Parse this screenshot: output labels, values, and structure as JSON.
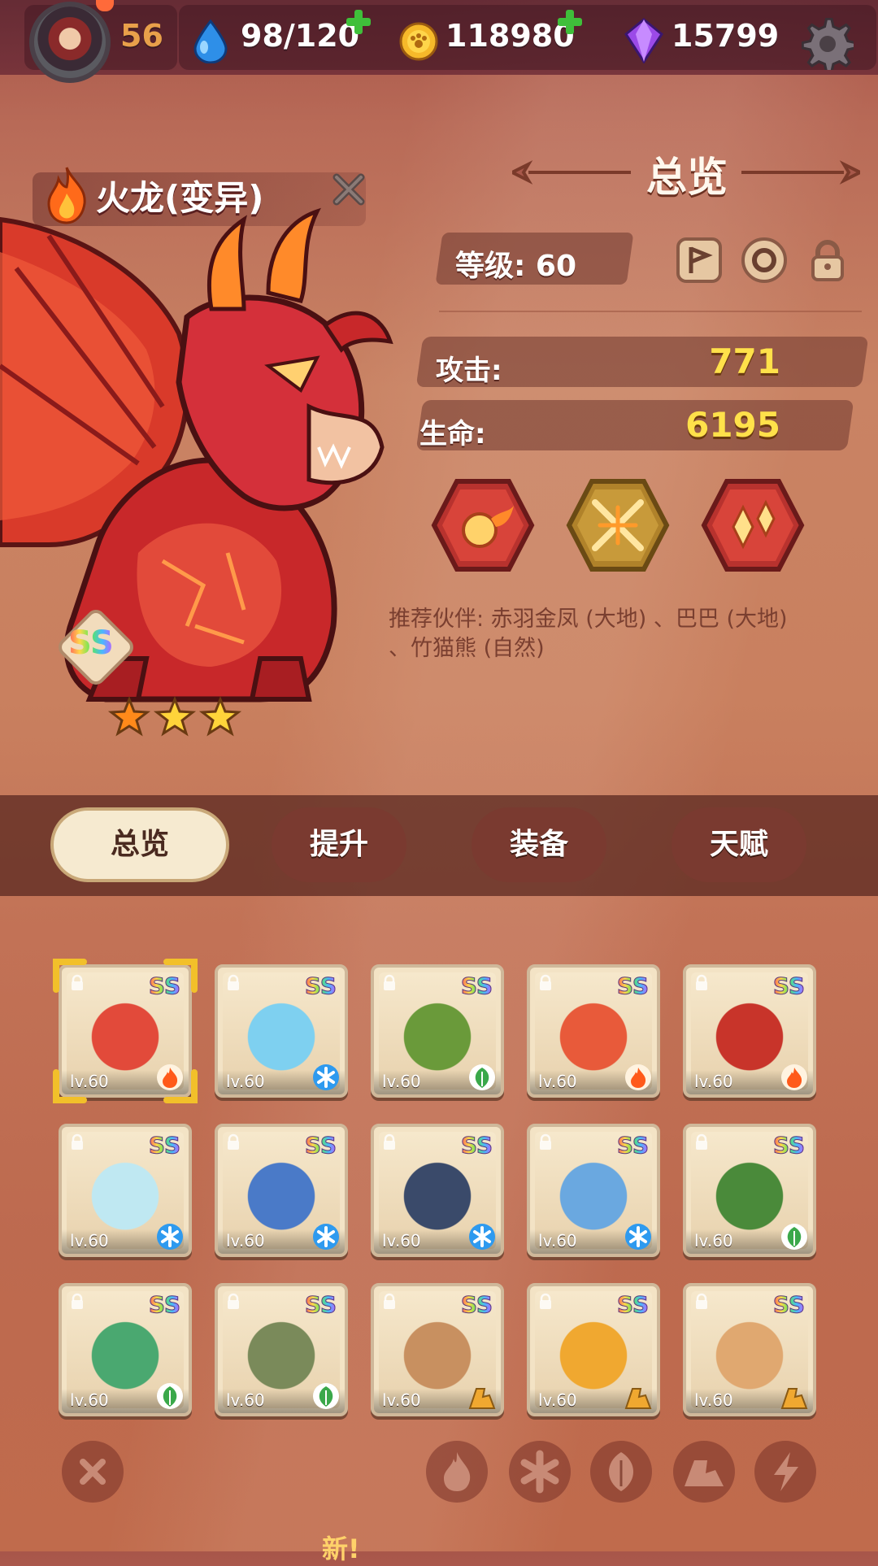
{
  "topbar": {
    "level": "56",
    "stamina": "98/120",
    "coins": "118980",
    "gems": "15799"
  },
  "pet": {
    "name": "火龙(变异)",
    "grade": "SS",
    "stars": 3,
    "element": "fire"
  },
  "overview": {
    "title": "总览",
    "level_label": "等级: 60",
    "attack_label": "攻击:",
    "attack_value": "771",
    "hp_label": "生命:",
    "hp_value": "6195",
    "skills": [
      "fireball-skill-icon",
      "crossed-blades-skill-icon",
      "flame-drops-skill-icon"
    ],
    "recommend": "推荐伙伴: 赤羽金凤 (大地) 、巴巴 (大地) 、竹猫熊 (自然)"
  },
  "tabs": [
    {
      "label": "总览",
      "active": true
    },
    {
      "label": "提升",
      "active": false
    },
    {
      "label": "装备",
      "active": false
    },
    {
      "label": "天赋",
      "active": false
    }
  ],
  "pets_grid": [
    {
      "name_icon": "fire-dragon-icon",
      "level": "lv.60",
      "grade": "SS",
      "element": "fire",
      "color": "#e24a3a",
      "selected": true
    },
    {
      "name_icon": "ice-phoenix-icon",
      "level": "lv.60",
      "grade": "SS",
      "element": "ice",
      "color": "#7ed0f0"
    },
    {
      "name_icon": "hooded-leaf-sprite-icon",
      "level": "lv.60",
      "grade": "SS",
      "element": "nature",
      "color": "#6a9a3a"
    },
    {
      "name_icon": "fire-imp-icon",
      "level": "lv.60",
      "grade": "SS",
      "element": "fire",
      "color": "#e85a3a"
    },
    {
      "name_icon": "lava-golem-icon",
      "level": "lv.60",
      "grade": "SS",
      "element": "fire",
      "color": "#c8342a"
    },
    {
      "name_icon": "frost-rabbit-icon",
      "level": "lv.60",
      "grade": "SS",
      "element": "ice",
      "color": "#bfe8f2"
    },
    {
      "name_icon": "snow-owl-icon",
      "level": "lv.60",
      "grade": "SS",
      "element": "ice",
      "color": "#4a7ac8"
    },
    {
      "name_icon": "crane-icon",
      "level": "lv.60",
      "grade": "SS",
      "element": "ice",
      "color": "#3a4a6a"
    },
    {
      "name_icon": "blue-tiger-icon",
      "level": "lv.60",
      "grade": "SS",
      "element": "ice",
      "color": "#6aa8e0"
    },
    {
      "name_icon": "cactus-icon",
      "level": "lv.60",
      "grade": "SS",
      "element": "nature",
      "color": "#4a8a3a"
    },
    {
      "name_icon": "leaf-fox-icon",
      "level": "lv.60",
      "grade": "SS",
      "element": "nature",
      "color": "#4aa870"
    },
    {
      "name_icon": "grey-wolf-icon",
      "level": "lv.60",
      "grade": "SS",
      "element": "nature",
      "color": "#7a8a5a"
    },
    {
      "name_icon": "horned-beast-icon",
      "level": "lv.60",
      "grade": "SS",
      "element": "earth",
      "color": "#c89060"
    },
    {
      "name_icon": "skull-dino-icon",
      "level": "lv.60",
      "grade": "SS",
      "element": "earth",
      "color": "#f0a830"
    },
    {
      "name_icon": "mud-blob-icon",
      "level": "lv.60",
      "grade": "SS",
      "element": "earth",
      "color": "#e0a870"
    }
  ],
  "filters": [
    "close-filter-icon",
    "fire-filter-icon",
    "ice-filter-icon",
    "nature-filter-icon",
    "earth-filter-icon",
    "lightning-filter-icon"
  ],
  "bottom_hint": "新!"
}
